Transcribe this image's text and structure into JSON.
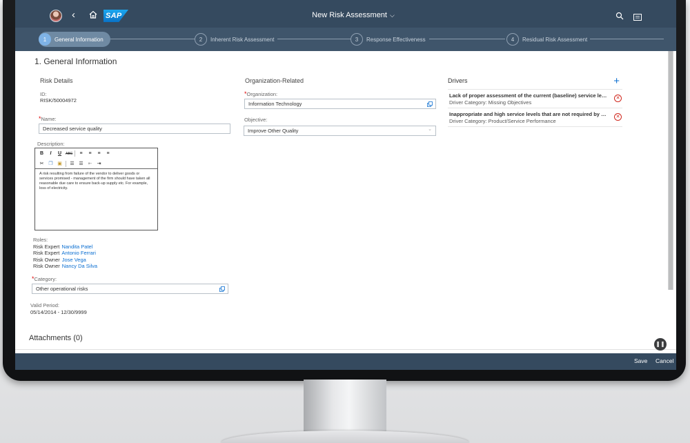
{
  "shell": {
    "title": "New Risk Assessment",
    "logo": "SAP"
  },
  "wizard": {
    "steps": [
      {
        "num": "1",
        "label": "General Information"
      },
      {
        "num": "2",
        "label": "Inherent Risk Assessment"
      },
      {
        "num": "3",
        "label": "Response Effectiveness"
      },
      {
        "num": "4",
        "label": "Residual Risk Assessment"
      }
    ]
  },
  "page": {
    "section_title": "1. General Information",
    "risk_details": {
      "title": "Risk Details",
      "id_label": "ID:",
      "id_value": "RISK/50004972",
      "name_label": "Name:",
      "name_value": "Decreased service quality",
      "description_label": "Description:",
      "description_text": "A risk resulting from failure of the vendor to deliver goods or services promised - management of the firm should have taken all reasonable due care to ensure back-up supply etc. For example, loss of electricity.",
      "roles_label": "Roles:",
      "roles": [
        {
          "role": "Risk Expert",
          "person": "Nandita Patel"
        },
        {
          "role": "Risk Expert",
          "person": "Antonio Ferrari"
        },
        {
          "role": "Risk Owner",
          "person": "Jose Vega"
        },
        {
          "role": "Risk Owner",
          "person": "Nancy Da Silva"
        }
      ],
      "category_label": "Category:",
      "category_value": "Other operational risks",
      "valid_period_label": "Valid Period:",
      "valid_period_value": "05/14/2014 - 12/30/9999"
    },
    "org": {
      "title": "Organization-Related",
      "organization_label": "Organization:",
      "organization_value": "Information Technology",
      "objective_label": "Objective:",
      "objective_value": "Improve Other Quality"
    },
    "drivers": {
      "title": "Drivers",
      "items": [
        {
          "title": "Lack of proper assessment of the current (baseline) service levels",
          "category": "Driver Category: Missing Objectives"
        },
        {
          "title": "Inappropriate and high service levels that are not required by business",
          "category": "Driver Category: Product/Service Performance"
        }
      ]
    },
    "attachments": "Attachments (0)"
  },
  "footer": {
    "save": "Save",
    "cancel": "Cancel"
  },
  "colors": {
    "shell": "#354a5f",
    "wizard": "#3f556b",
    "link": "#0a6ed1",
    "delete": "#d0271d"
  }
}
